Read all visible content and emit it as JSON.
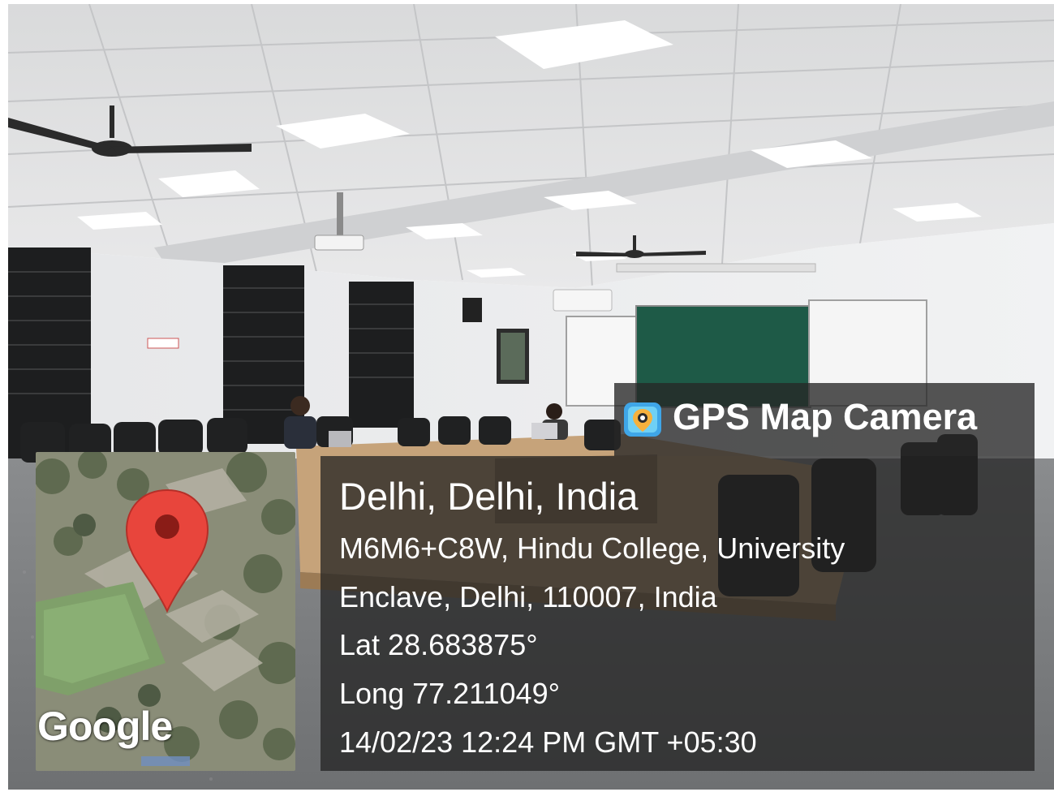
{
  "overlay": {
    "app_name": "GPS Map Camera",
    "app_icon": "map-pin-camera-icon",
    "location_title": "Delhi, Delhi, India",
    "address_line_1": "M6M6+C8W, Hindu College, University",
    "address_line_2": "Enclave, Delhi, 110007, India",
    "latitude": "Lat 28.683875°",
    "longitude": "Long 77.211049°",
    "timestamp": "14/02/23 12:24 PM GMT +05:30"
  },
  "map": {
    "attribution": "Google",
    "marker_icon": "map-marker-icon",
    "marker_color": "#e8453c"
  },
  "colors": {
    "panel_bg": "#262626",
    "text": "#ffffff",
    "chalkboard": "#1e5a47"
  }
}
